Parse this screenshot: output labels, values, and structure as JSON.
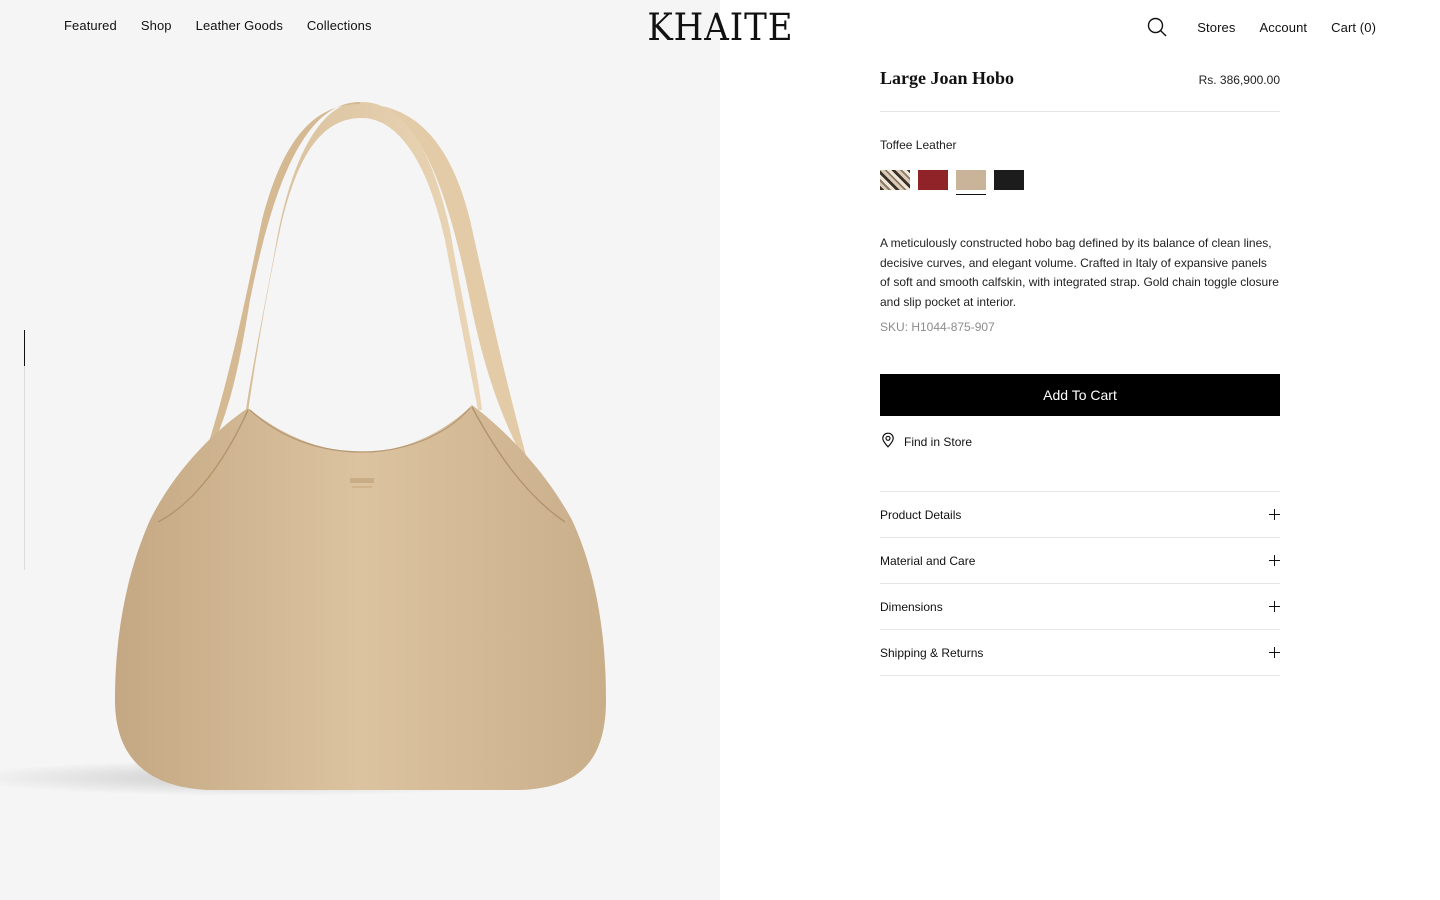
{
  "header": {
    "logo": "KHAITE",
    "nav_left": [
      "Featured",
      "Shop",
      "Leather Goods",
      "Collections"
    ],
    "nav_right": {
      "stores": "Stores",
      "account": "Account",
      "cart": "Cart (0)"
    },
    "icons": {
      "search": "search-icon"
    }
  },
  "gallery": {
    "image": "toffee-leather-hobo-bag",
    "icons": {
      "scroll": "scroll-indicator"
    }
  },
  "product": {
    "title": "Large Joan Hobo",
    "price": "Rs. 386,900.00",
    "color_label": "Toffee Leather",
    "swatches": [
      {
        "name": "Python",
        "color": "#b8a58a",
        "selected": false
      },
      {
        "name": "Red",
        "color": "#8f2327",
        "selected": false
      },
      {
        "name": "Toffee Leather",
        "color": "#c9b49a",
        "selected": true
      },
      {
        "name": "Black",
        "color": "#1c1c1c",
        "selected": false
      }
    ],
    "description": "A meticulously constructed hobo bag defined by its balance of clean lines, decisive curves, and elegant volume. Crafted in Italy of expansive panels of soft and smooth calfskin, with integrated strap. Gold chain toggle closure and slip pocket at interior.",
    "sku": "SKU: H1044-875-907",
    "add_to_cart": "Add To Cart",
    "find_in_store": "Find in Store",
    "icons": {
      "find_in_store": "map-pin-icon",
      "accordion": "plus-icon"
    },
    "accordion": [
      "Product Details",
      "Material and Care",
      "Dimensions",
      "Shipping & Returns"
    ]
  },
  "colors": {
    "accent": "#000000",
    "gallery_bg": "#f5f5f5",
    "divider": "#e6e6e6"
  }
}
